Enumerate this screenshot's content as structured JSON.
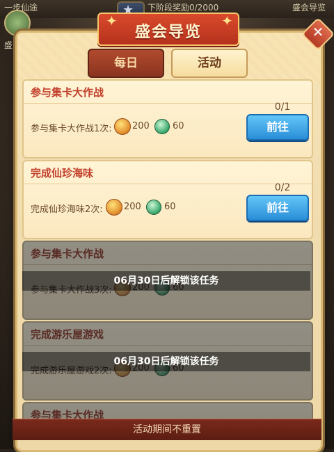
{
  "background": {
    "top_left_text": "一步仙途",
    "top_center_text": "下阶段奖励0/2000",
    "top_right_text": "盛会导览",
    "left_label": "盛"
  },
  "dialog": {
    "title": "盛会导览",
    "tabs": [
      {
        "label": "每日",
        "selected": false
      },
      {
        "label": "活动",
        "selected": true
      }
    ],
    "tasks": [
      {
        "title": "参与集卡大作战",
        "desc": "参与集卡大作战1次:",
        "coin": "200",
        "gem": "60",
        "progress": "0/1",
        "button": "前往",
        "locked": false
      },
      {
        "title": "完成仙珍海味",
        "desc": "完成仙珍海味2次:",
        "coin": "200",
        "gem": "60",
        "progress": "0/2",
        "button": "前往",
        "locked": false
      },
      {
        "title": "参与集卡大作战",
        "desc": "参与集卡大作战3次:",
        "coin": "200",
        "gem": "60",
        "lock_text": "06月30日后解锁该任务",
        "locked": true
      },
      {
        "title": "完成游乐屋游戏",
        "desc": "完成游乐屋游戏2次:",
        "coin": "200",
        "gem": "60",
        "lock_text": "06月30日后解锁该任务",
        "locked": true
      },
      {
        "title": "参与集卡大作战",
        "locked": true
      }
    ],
    "footer": "活动期间不重置"
  },
  "colors": {
    "title_red": "#c2402c",
    "button_blue": "#2a8ed8",
    "panel_bg": "#f5e3b8"
  }
}
